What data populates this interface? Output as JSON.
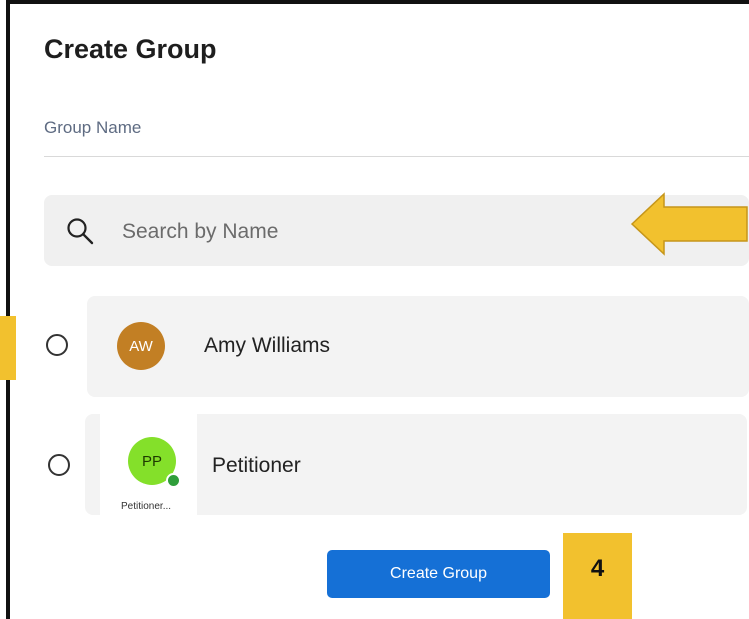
{
  "dialog": {
    "title": "Create Group",
    "group_name_label": "Group Name"
  },
  "search": {
    "placeholder": "Search by Name",
    "icon": "search-icon"
  },
  "members": [
    {
      "initials": "AW",
      "name": "Amy Williams",
      "avatar_color": "#c27f24",
      "selected": false
    },
    {
      "initials": "PP",
      "name": "Petitioner",
      "caption": "Petitioner...",
      "avatar_color": "#84e02a",
      "status": "online",
      "selected": false
    }
  ],
  "actions": {
    "create_label": "Create Group"
  },
  "annotations": {
    "step_number": "4",
    "arrow_color": "#f2c12e"
  },
  "colors": {
    "primary": "#1570d6",
    "highlight": "#f2c12e",
    "row_background": "#f3f3f3"
  }
}
